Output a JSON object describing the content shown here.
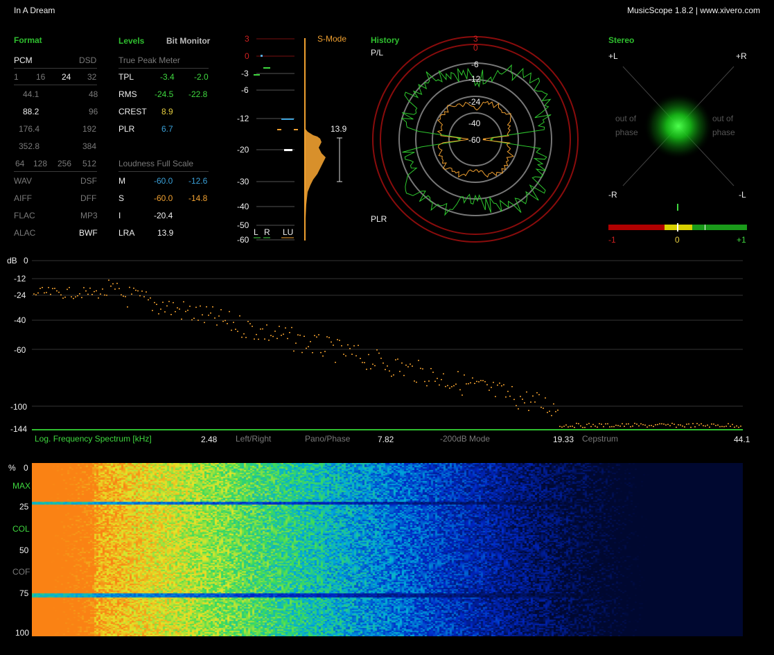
{
  "window": {
    "title": "In A Dream",
    "app": "MusicScope 1.8.2 | www.xivero.com"
  },
  "format": {
    "header": "Format",
    "pcm": "PCM",
    "dsd": "DSD",
    "bits": [
      "1",
      "16",
      "24",
      "32"
    ],
    "rates": [
      [
        "44.1",
        "48"
      ],
      [
        "88.2",
        "96"
      ],
      [
        "176.4",
        "192"
      ],
      [
        "352.8",
        "384"
      ]
    ],
    "dsd_rates": [
      "64",
      "128",
      "256",
      "512"
    ],
    "files": [
      [
        "WAV",
        "DSF"
      ],
      [
        "AIFF",
        "DFF"
      ],
      [
        "FLAC",
        "MP3"
      ],
      [
        "ALAC",
        "BWF"
      ]
    ],
    "selected": {
      "bits": "24",
      "rate": "88.2",
      "file": "BWF"
    }
  },
  "levels": {
    "header": "Levels",
    "bit_monitor": "Bit Monitor",
    "tpm_title": "True Peak Meter",
    "rows": [
      {
        "label": "TPL",
        "l": "-3.4",
        "r": "-2.0"
      },
      {
        "label": "RMS",
        "l": "-24.5",
        "r": "-22.8"
      },
      {
        "label": "CREST",
        "l": "8.9",
        "r": ""
      },
      {
        "label": "PLR",
        "l": "6.7",
        "r": ""
      }
    ],
    "loud_title": "Loudness Full Scale",
    "loud_rows": [
      {
        "label": "M",
        "l": "-60.0",
        "r": "-12.6"
      },
      {
        "label": "S",
        "l": "-60.0",
        "r": "-14.8"
      },
      {
        "label": "I",
        "l": "-20.4",
        "r": ""
      },
      {
        "label": "LRA",
        "l": "13.9",
        "r": ""
      }
    ]
  },
  "meter": {
    "ticks": [
      "3",
      "0",
      "-3",
      "-6",
      "-12",
      "-20",
      "-30",
      "-40",
      "-50",
      "-60"
    ],
    "mode": "S-Mode",
    "lra_value": "13.9",
    "legend": [
      "L",
      "R",
      "LU"
    ]
  },
  "history": {
    "header": "History",
    "top": "P/L",
    "bottom": "PLR",
    "rings": [
      "3",
      "0",
      "-6",
      "-12",
      "-24",
      "-40",
      "-60"
    ]
  },
  "stereo": {
    "header": "Stereo",
    "pl": "+L",
    "pr": "+R",
    "ml": "-R",
    "mr": "-L",
    "oop_left": [
      "out of",
      "phase"
    ],
    "oop_right": [
      "out of",
      "phase"
    ],
    "scale": [
      "-1",
      "0",
      "+1"
    ]
  },
  "spectrum": {
    "db_label": "dB",
    "y_ticks": [
      "0",
      "-12",
      "-24",
      "-40",
      "-60",
      "-100",
      "-144"
    ],
    "mode_label": "Log. Frequency Spectrum [kHz]",
    "x_labels": [
      "2.48",
      "7.82",
      "19.33",
      "44.1"
    ],
    "options": [
      "Left/Right",
      "Pano/Phase",
      "-200dB Mode",
      "Cepstrum"
    ]
  },
  "spectrogram": {
    "y_ticks": [
      "%",
      "0",
      "25",
      "50",
      "75",
      "100"
    ],
    "side_labels": [
      "MAX",
      "COL",
      "COF"
    ]
  },
  "colors": {
    "green": "#2fbf2f",
    "orange": "#f0a030",
    "red": "#d02020",
    "blue": "#3aa0d8"
  }
}
